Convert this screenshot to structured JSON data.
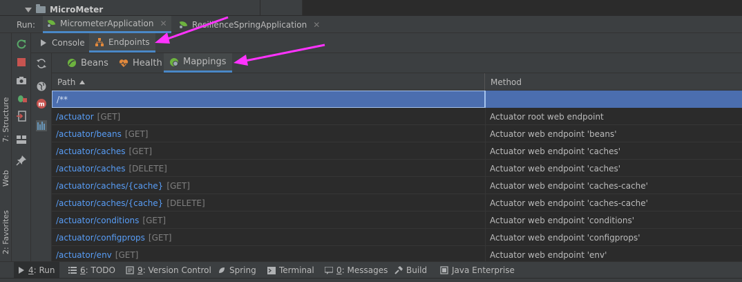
{
  "project_tree": {
    "node_label": "MicroMeter"
  },
  "run_window": {
    "label": "Run:",
    "tabs": [
      {
        "label": "MicrometerApplication",
        "active": true
      },
      {
        "label": "ResilienceSpringApplication",
        "active": false
      }
    ]
  },
  "left_stripe": {
    "structure": "7: Structure",
    "web": "Web",
    "favorites": "2: Favorites"
  },
  "sub_tabs": [
    {
      "label": "Console",
      "icon": "console-icon",
      "active": false
    },
    {
      "label": "Endpoints",
      "icon": "endpoints-icon",
      "active": true
    }
  ],
  "endpoint_tabs": [
    {
      "label": "Beans",
      "icon": "beans-icon",
      "active": false
    },
    {
      "label": "Health",
      "icon": "health-heart-icon",
      "active": false
    },
    {
      "label": "Mappings",
      "icon": "mappings-icon",
      "active": true
    }
  ],
  "table": {
    "columns": [
      "Path",
      "Method"
    ],
    "sort_column": "Path",
    "rows": [
      {
        "path": "/**",
        "verb": "",
        "method": ""
      },
      {
        "path": "/actuator",
        "verb": "[GET]",
        "method": "Actuator root web endpoint"
      },
      {
        "path": "/actuator/beans",
        "verb": "[GET]",
        "method": "Actuator web endpoint 'beans'"
      },
      {
        "path": "/actuator/caches",
        "verb": "[GET]",
        "method": "Actuator web endpoint 'caches'"
      },
      {
        "path": "/actuator/caches",
        "verb": "[DELETE]",
        "method": "Actuator web endpoint 'caches'"
      },
      {
        "path": "/actuator/caches/{cache}",
        "verb": "[GET]",
        "method": "Actuator web endpoint 'caches-cache'"
      },
      {
        "path": "/actuator/caches/{cache}",
        "verb": "[DELETE]",
        "method": "Actuator web endpoint 'caches-cache'"
      },
      {
        "path": "/actuator/conditions",
        "verb": "[GET]",
        "method": "Actuator web endpoint 'conditions'"
      },
      {
        "path": "/actuator/configprops",
        "verb": "[GET]",
        "method": "Actuator web endpoint 'configprops'"
      },
      {
        "path": "/actuator/env",
        "verb": "[GET]",
        "method": "Actuator web endpoint 'env'"
      }
    ]
  },
  "bottom_bar": [
    {
      "key": "4",
      "label": ": Run",
      "icon": "run-icon",
      "active": true
    },
    {
      "key": "6",
      "label": ": TODO",
      "icon": "todo-icon",
      "active": false
    },
    {
      "key": "9",
      "label": ": Version Control",
      "icon": "vcs-icon",
      "active": false
    },
    {
      "key": "",
      "label": "Spring",
      "icon": "spring-icon",
      "active": false
    },
    {
      "key": "",
      "label": "Terminal",
      "icon": "terminal-icon",
      "active": false
    },
    {
      "key": "0",
      "label": ": Messages",
      "icon": "messages-icon",
      "active": false
    },
    {
      "key": "",
      "label": "Build",
      "icon": "build-icon",
      "active": false
    },
    {
      "key": "",
      "label": "Java Enterprise",
      "icon": "java-enterprise-icon",
      "active": false
    }
  ],
  "colors": {
    "background": "#3c3f41",
    "table_background": "#2b2b2b",
    "selection": "#4b6eaf",
    "accent_underline": "#4a88c7",
    "link": "#589df6",
    "annotation_arrow": "#ff33ff"
  }
}
